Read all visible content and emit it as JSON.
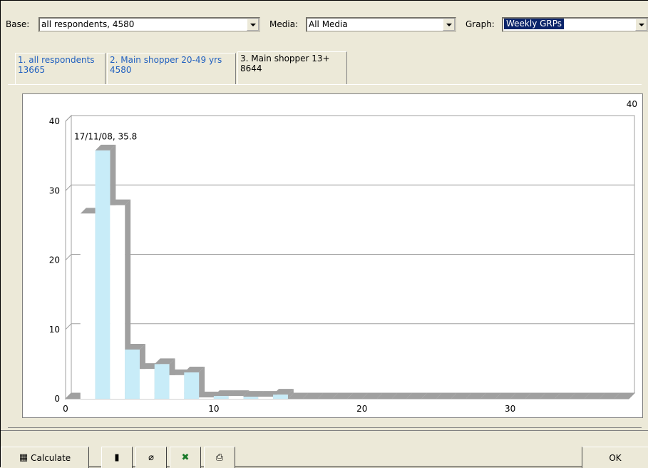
{
  "toolbar": {
    "base_label": "Base:",
    "base_value": "all respondents, 4580",
    "media_label": "Media:",
    "media_value": "All Media",
    "graph_label": "Graph:",
    "graph_value": "Weekly GRPs"
  },
  "tabs": [
    {
      "line1": "1. all respondents",
      "line2": "13665"
    },
    {
      "line1": "2. Main shopper 20-49 yrs",
      "line2": "4580"
    },
    {
      "line1": "3. Main shopper 13+",
      "line2": "8644"
    }
  ],
  "buttons": {
    "calculate": "Calculate",
    "ok": "OK"
  },
  "icons": [
    "calculator-icon",
    "chart-icon",
    "eraser-icon",
    "excel-icon",
    "printer-icon"
  ],
  "chart_data": {
    "type": "bar",
    "annotation": "17/11/08, 35.8",
    "top_right_label": "40",
    "x": [
      0,
      1,
      2,
      3,
      4,
      5,
      6,
      7,
      8,
      9,
      10,
      11,
      12,
      13,
      14,
      15,
      16,
      17,
      18,
      19,
      20,
      21,
      22,
      23,
      24,
      25,
      26,
      27,
      28,
      29,
      30,
      31,
      32,
      33,
      34,
      35,
      36,
      37
    ],
    "values": [
      0,
      26.7,
      35.8,
      27.9,
      7.1,
      4.3,
      5.0,
      3.4,
      3.8,
      0.2,
      0.4,
      0.4,
      0.3,
      0.3,
      0.6,
      0,
      0,
      0,
      0,
      0,
      0,
      0,
      0,
      0,
      0,
      0,
      0,
      0,
      0,
      0,
      0,
      0,
      0,
      0,
      0,
      0,
      0,
      0
    ],
    "colors": {
      "odd": "#ffffff",
      "even": "#c8ecf8",
      "shadow": "#a0a0a0"
    },
    "ylim": [
      0,
      40
    ],
    "yticks": [
      "0",
      "10",
      "20",
      "30",
      "40"
    ],
    "xticks": [
      "0",
      "10",
      "20",
      "30"
    ],
    "xtick_values": [
      0,
      10,
      20,
      30
    ],
    "ytick_values": [
      0,
      10,
      20,
      30,
      40
    ],
    "grid": true
  }
}
